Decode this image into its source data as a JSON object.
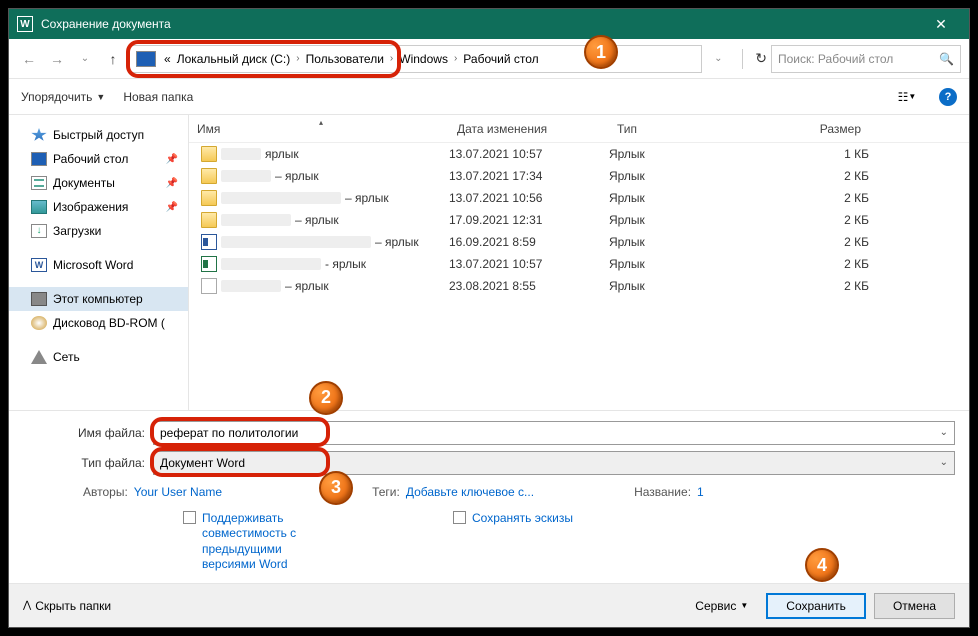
{
  "titlebar": {
    "title": "Сохранение документа",
    "close": "✕"
  },
  "breadcrumb": {
    "prefix": "«",
    "items": [
      "Локальный диск (C:)",
      "Пользователи",
      "Windows",
      "Рабочий стол"
    ]
  },
  "search": {
    "placeholder": "Поиск: Рабочий стол"
  },
  "toolbar": {
    "organize": "Упорядочить",
    "newfolder": "Новая папка"
  },
  "sidebar": {
    "quick": "Быстрый доступ",
    "desktop": "Рабочий стол",
    "docs": "Документы",
    "pics": "Изображения",
    "dl": "Загрузки",
    "word": "Microsoft Word",
    "pc": "Этот компьютер",
    "bd": "Дисковод BD-ROM (",
    "net": "Сеть"
  },
  "columns": {
    "name": "Имя",
    "date": "Дата изменения",
    "type": "Тип",
    "size": "Размер"
  },
  "files": [
    {
      "icon": "folder",
      "nw": 40,
      "suffix": "ярлык",
      "date": "13.07.2021 10:57",
      "type": "Ярлык",
      "size": "1 КБ"
    },
    {
      "icon": "folder",
      "nw": 50,
      "suffix": " – ярлык",
      "date": "13.07.2021 17:34",
      "type": "Ярлык",
      "size": "2 КБ"
    },
    {
      "icon": "folder",
      "nw": 120,
      "suffix": " – ярлык",
      "date": "13.07.2021 10:56",
      "type": "Ярлык",
      "size": "2 КБ"
    },
    {
      "icon": "folder",
      "nw": 70,
      "suffix": " – ярлык",
      "date": "17.09.2021 12:31",
      "type": "Ярлык",
      "size": "2 КБ"
    },
    {
      "icon": "doc",
      "nw": 150,
      "suffix": " – ярлык",
      "date": "16.09.2021 8:59",
      "type": "Ярлык",
      "size": "2 КБ"
    },
    {
      "icon": "xls",
      "nw": 100,
      "suffix": " - ярлык",
      "date": "13.07.2021 10:57",
      "type": "Ярлык",
      "size": "2 КБ"
    },
    {
      "icon": "generic",
      "nw": 60,
      "suffix": " – ярлык",
      "date": "23.08.2021 8:55",
      "type": "Ярлык",
      "size": "2 КБ"
    }
  ],
  "form": {
    "filename_label": "Имя файла:",
    "filename_value": "реферат по политологии",
    "filetype_label": "Тип файла:",
    "filetype_value": "Документ Word",
    "authors_label": "Авторы:",
    "authors_value": "Your User Name",
    "tags_label": "Теги:",
    "tags_value": "Добавьте ключевое с...",
    "title_label": "Название:",
    "title_value": "1",
    "compat": "Поддерживать совместимость с предыдущими версиями Word",
    "thumbs": "Сохранять эскизы"
  },
  "footer": {
    "hide": "Скрыть папки",
    "service": "Сервис",
    "save": "Сохранить",
    "cancel": "Отмена"
  },
  "markers": {
    "m1": "1",
    "m2": "2",
    "m3": "3",
    "m4": "4"
  }
}
